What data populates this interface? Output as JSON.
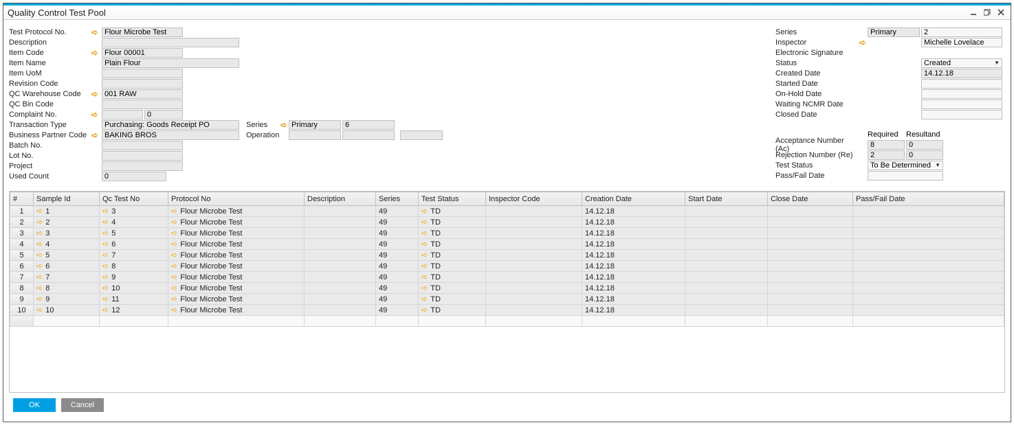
{
  "window": {
    "title": "Quality Control Test Pool"
  },
  "left": {
    "test_protocol_no_lbl": "Test Protocol No.",
    "test_protocol_no": "Flour Microbe Test",
    "description_lbl": "Description",
    "description": "",
    "item_code_lbl": "Item Code",
    "item_code": "Flour 00001",
    "item_name_lbl": "Item Name",
    "item_name": "Plain Flour",
    "item_uom_lbl": "Item UoM",
    "item_uom": "",
    "revision_code_lbl": "Revision Code",
    "revision_code": "",
    "qc_wh_code_lbl": "QC Warehouse Code",
    "qc_wh_code": "001 RAW",
    "qc_bin_code_lbl": "QC Bin Code",
    "qc_bin_code": "",
    "complaint_no_lbl": "Complaint No.",
    "complaint_no": "0",
    "transaction_type_lbl": "Transaction Type",
    "transaction_type": "Purchasing: Goods Receipt PO",
    "bp_code_lbl": "Business Partner Code",
    "bp_code": "BAKING BROS",
    "batch_no_lbl": "Batch No.",
    "batch_no": "",
    "lot_no_lbl": "Lot No.",
    "lot_no": "",
    "project_lbl": "Project",
    "project": "",
    "used_count_lbl": "Used Count",
    "used_count": "0",
    "mid_series_lbl": "Series",
    "mid_series": "Primary",
    "mid_series_num": "6",
    "operation_lbl": "Operation",
    "operation_a": "",
    "operation_b": "",
    "operation_c": ""
  },
  "right": {
    "series_lbl": "Series",
    "series": "Primary",
    "series_num": "2",
    "inspector_lbl": "Inspector",
    "inspector": "Michelle Lovelace",
    "esig_lbl": "Electronic Signature",
    "status_lbl": "Status",
    "status": "Created",
    "created_date_lbl": "Created Date",
    "created_date": "14.12.18",
    "started_date_lbl": "Started Date",
    "started_date": "",
    "onhold_date_lbl": "On-Hold Date",
    "onhold_date": "",
    "waiting_ncmr_lbl": "Waiting NCMR Date",
    "waiting_ncmr": "",
    "closed_date_lbl": "Closed Date",
    "closed_date": "",
    "required_hdr": "Required",
    "resultand_hdr": "Resultand",
    "acc_lbl": "Acceptance Number (Ac)",
    "acc_req": "8",
    "acc_res": "0",
    "rej_lbl": "Rejection Number (Re)",
    "rej_req": "2",
    "rej_res": "0",
    "test_status_lbl": "Test Status",
    "test_status": "To Be Determined",
    "passfail_lbl": "Pass/Fail Date",
    "passfail": ""
  },
  "grid": {
    "headers": {
      "num": "#",
      "sample_id": "Sample Id",
      "qc_test_no": "Qc Test No",
      "protocol_no": "Protocol No",
      "description": "Description",
      "series": "Series",
      "test_status": "Test Status",
      "inspector_code": "Inspector Code",
      "creation_date": "Creation Date",
      "start_date": "Start Date",
      "close_date": "Close Date",
      "passfail_date": "Pass/Fail Date"
    },
    "rows": [
      {
        "num": "1",
        "sample_id": "1",
        "qc_test_no": "3",
        "protocol_no": "Flour Microbe Test",
        "description": "",
        "series": "49",
        "test_status": "TD",
        "inspector_code": "",
        "creation_date": "14.12.18",
        "start_date": "",
        "close_date": "",
        "passfail_date": ""
      },
      {
        "num": "2",
        "sample_id": "2",
        "qc_test_no": "4",
        "protocol_no": "Flour Microbe Test",
        "description": "",
        "series": "49",
        "test_status": "TD",
        "inspector_code": "",
        "creation_date": "14.12.18",
        "start_date": "",
        "close_date": "",
        "passfail_date": ""
      },
      {
        "num": "3",
        "sample_id": "3",
        "qc_test_no": "5",
        "protocol_no": "Flour Microbe Test",
        "description": "",
        "series": "49",
        "test_status": "TD",
        "inspector_code": "",
        "creation_date": "14.12.18",
        "start_date": "",
        "close_date": "",
        "passfail_date": ""
      },
      {
        "num": "4",
        "sample_id": "4",
        "qc_test_no": "6",
        "protocol_no": "Flour Microbe Test",
        "description": "",
        "series": "49",
        "test_status": "TD",
        "inspector_code": "",
        "creation_date": "14.12.18",
        "start_date": "",
        "close_date": "",
        "passfail_date": ""
      },
      {
        "num": "5",
        "sample_id": "5",
        "qc_test_no": "7",
        "protocol_no": "Flour Microbe Test",
        "description": "",
        "series": "49",
        "test_status": "TD",
        "inspector_code": "",
        "creation_date": "14.12.18",
        "start_date": "",
        "close_date": "",
        "passfail_date": ""
      },
      {
        "num": "6",
        "sample_id": "6",
        "qc_test_no": "8",
        "protocol_no": "Flour Microbe Test",
        "description": "",
        "series": "49",
        "test_status": "TD",
        "inspector_code": "",
        "creation_date": "14.12.18",
        "start_date": "",
        "close_date": "",
        "passfail_date": ""
      },
      {
        "num": "7",
        "sample_id": "7",
        "qc_test_no": "9",
        "protocol_no": "Flour Microbe Test",
        "description": "",
        "series": "49",
        "test_status": "TD",
        "inspector_code": "",
        "creation_date": "14.12.18",
        "start_date": "",
        "close_date": "",
        "passfail_date": ""
      },
      {
        "num": "8",
        "sample_id": "8",
        "qc_test_no": "10",
        "protocol_no": "Flour Microbe Test",
        "description": "",
        "series": "49",
        "test_status": "TD",
        "inspector_code": "",
        "creation_date": "14.12.18",
        "start_date": "",
        "close_date": "",
        "passfail_date": ""
      },
      {
        "num": "9",
        "sample_id": "9",
        "qc_test_no": "11",
        "protocol_no": "Flour Microbe Test",
        "description": "",
        "series": "49",
        "test_status": "TD",
        "inspector_code": "",
        "creation_date": "14.12.18",
        "start_date": "",
        "close_date": "",
        "passfail_date": ""
      },
      {
        "num": "10",
        "sample_id": "10",
        "qc_test_no": "12",
        "protocol_no": "Flour Microbe Test",
        "description": "",
        "series": "49",
        "test_status": "TD",
        "inspector_code": "",
        "creation_date": "14.12.18",
        "start_date": "",
        "close_date": "",
        "passfail_date": ""
      }
    ]
  },
  "footer": {
    "ok": "OK",
    "cancel": "Cancel"
  }
}
